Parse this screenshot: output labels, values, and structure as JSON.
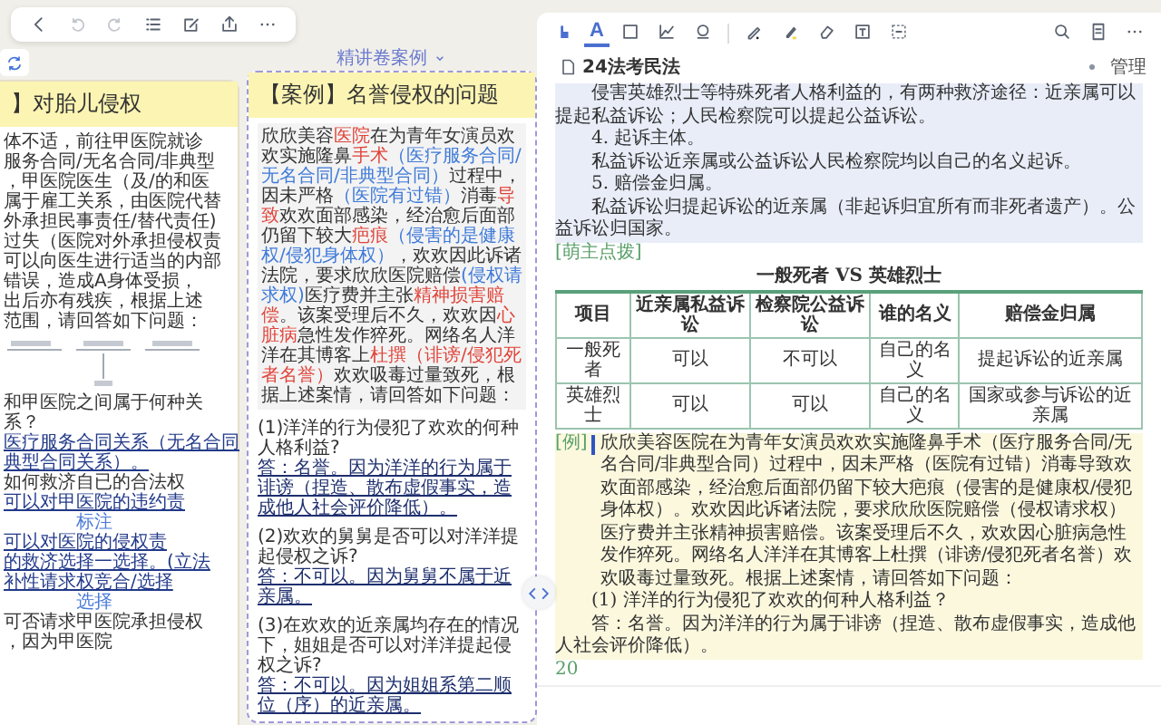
{
  "section_label": "精讲卷案例",
  "left_card": {
    "title": "】对胎儿侵权",
    "lines": [
      {
        "kind": "plain",
        "text": "体不适，前往甲医院就诊"
      },
      {
        "kind": "plain",
        "text": "服务合同/无名合同/非典型"
      },
      {
        "kind": "plain",
        "text": "，甲医院医生（及/的和医"
      },
      {
        "kind": "plain",
        "text": "属于雇工关系，由医院代替"
      },
      {
        "kind": "plain",
        "text": "外承担民事责任/替代责任)"
      },
      {
        "kind": "plain",
        "text": "过失（医院对外承担侵权责"
      },
      {
        "kind": "plain",
        "text": "可以向医生进行适当的内部"
      },
      {
        "kind": "plain",
        "text": "错误，造成A身体受损，"
      },
      {
        "kind": "plain",
        "text": "出后亦有残疾，根据上述"
      },
      {
        "kind": "plain",
        "text": "范围，请回答如下问题："
      },
      {
        "kind": "diagram"
      },
      {
        "kind": "plain",
        "text": "和甲医院之间属于何种关"
      },
      {
        "kind": "plain",
        "text": "系？"
      },
      {
        "kind": "answer",
        "text": "医疗服务合同关系（无名合同"
      },
      {
        "kind": "answer",
        "text": "典型合同关系）。"
      },
      {
        "kind": "plain",
        "text": "如何救济自已的合法权"
      },
      {
        "kind": "answer",
        "text": "可以对甲医院的违约责"
      },
      {
        "kind": "tag",
        "text": "标注"
      },
      {
        "kind": "answer",
        "text": "可以对医院的侵权责"
      },
      {
        "kind": "answer",
        "text": "的救济选择一选择。(立法"
      },
      {
        "kind": "answer",
        "text": "补性请求权竞合/选择"
      },
      {
        "kind": "tag",
        "text": "选择"
      },
      {
        "kind": "plain",
        "text": "可否请求甲医院承担侵权"
      },
      {
        "kind": "plain",
        "text": "，因为甲医院"
      }
    ]
  },
  "case_card": {
    "title": "【案例】名誉侵权的问题",
    "selected": true,
    "segments": [
      {
        "kind": "plain",
        "text": "欣欣美容"
      },
      {
        "kind": "red",
        "text": "医院"
      },
      {
        "kind": "plain",
        "text": "在为青年女演员欢欢实施隆鼻"
      },
      {
        "kind": "red",
        "text": "手术"
      },
      {
        "kind": "blue",
        "text": "（医疗服务合同/无名合同/非典型合同）"
      },
      {
        "kind": "plain",
        "text": "过程中，因未严格"
      },
      {
        "kind": "blue",
        "text": "（医院有过错）"
      },
      {
        "kind": "plain",
        "text": "消毒"
      },
      {
        "kind": "red",
        "text": "导致"
      },
      {
        "kind": "plain",
        "text": "欢欢面部感染，经治愈后面部仍留下较大"
      },
      {
        "kind": "red",
        "text": "疤痕"
      },
      {
        "kind": "blue",
        "text": "（侵害的是健康权/侵犯身体权）"
      },
      {
        "kind": "plain",
        "text": "，欢欢因此诉诸法院，要求欣欣医院赔偿"
      },
      {
        "kind": "blue",
        "text": "(侵权请求权)"
      },
      {
        "kind": "plain",
        "text": "医疗费并主张"
      },
      {
        "kind": "red",
        "text": "精神损害赔偿"
      },
      {
        "kind": "plain",
        "text": "。该案受理后不久，欢欢因"
      },
      {
        "kind": "red",
        "text": "心脏病"
      },
      {
        "kind": "plain",
        "text": "急性发作猝死。网络名人洋洋在其博客上"
      },
      {
        "kind": "red",
        "text": "杜撰（诽谤/侵犯死者名誉）"
      },
      {
        "kind": "plain",
        "text": "欢欢吸毒过量致死，根据上述案情，请回答如下问题："
      }
    ],
    "qa": [
      {
        "question": "(1)洋洋的行为侵犯了欢欢的何种人格利益?",
        "answer": "答：名誉。因为洋洋的行为属于诽谤（捏造、散布虚假事实，造成他人社会评价降低）。"
      },
      {
        "question": "(2)欢欢的舅舅是否可以对洋洋提起侵权之诉?",
        "answer": "答：不可以。因为舅舅不属于近亲属。"
      },
      {
        "question": "(3)在欢欢的近亲属均存在的情况下，姐姐是否可以对洋洋提起侵权之诉?",
        "answer": "答：不可以。因为姐姐系第二顺位（序）的近亲属。"
      }
    ]
  },
  "tools": [
    {
      "kind": "hand",
      "selected": false
    },
    {
      "kind": "text",
      "label": "A",
      "selected": true
    },
    {
      "kind": "rect",
      "selected": false
    },
    {
      "kind": "chart",
      "selected": false
    },
    {
      "kind": "stamp",
      "selected": false
    },
    {
      "kind": "pen",
      "selected": false
    },
    {
      "kind": "highlighter",
      "selected": false
    },
    {
      "kind": "eraser",
      "selected": false
    },
    {
      "kind": "textbox",
      "selected": false
    },
    {
      "kind": "select",
      "selected": false
    }
  ],
  "tab": {
    "title": "24法考民法",
    "selected": true
  },
  "manage": "管理",
  "blocks": [
    {
      "kind": "para",
      "text": "侵害英雄烈士等特殊死者人格利益的，有两种救济途径：近亲属可以提起私益诉讼；人民检察院可以提起公益诉讼。"
    },
    {
      "kind": "para",
      "text": "4. 起诉主体。"
    },
    {
      "kind": "para",
      "text": "私益诉讼近亲属或公益诉讼人民检察院均以自己的名义起诉。"
    },
    {
      "kind": "para",
      "text": "5. 赔偿金归属。"
    },
    {
      "kind": "para",
      "text": "私益诉讼归提起诉讼的近亲属（非起诉归宜所有而非死者遗产）。公益诉讼归国家。"
    },
    {
      "kind": "tip",
      "text": "[萌主点拨]"
    },
    {
      "kind": "table",
      "title": "一般死者 VS 英雄烈士",
      "columns": [
        "项目",
        "近亲属私益诉讼",
        "检察院公益诉讼",
        "谁的名义",
        "赔偿金归属"
      ],
      "rows": [
        [
          "一般死者",
          "可以",
          "不可以",
          "自己的名义",
          "提起诉讼的近亲属"
        ],
        [
          "英雄烈士",
          "可以",
          "可以",
          "自己的名义",
          "国家或参与诉讼的近亲属"
        ]
      ]
    },
    {
      "kind": "example",
      "tag": "[例]",
      "text": "欣欣美容医院在为青年女演员欢欢实施隆鼻手术（医疗服务合同/无名合同/非典型合同）过程中，因未严格（医院有过错）消毒导致欢欢面部感染，经治愈后面部仍留下较大疤痕（侵害的是健康权/侵犯身体权）。欢欢因此诉诸法院，要求欣欣医院赔偿（侵权请求权）医疗费并主张精神损害赔偿。该案受理后不久，欢欢因心脏病急性发作猝死。网络名人洋洋在其博客上杜撰（诽谤/侵犯死者名誉）欢欢吸毒过量致死。根据上述案情，请回答如下问题："
    },
    {
      "kind": "question",
      "text": "(1) 洋洋的行为侵犯了欢欢的何种人格利益？"
    },
    {
      "kind": "answer",
      "text": "答：名誉。因为洋洋的行为属于诽谤（捏造、散布虚假事实，造成他人社会评价降低）。"
    },
    {
      "kind": "page",
      "text": "20"
    }
  ]
}
